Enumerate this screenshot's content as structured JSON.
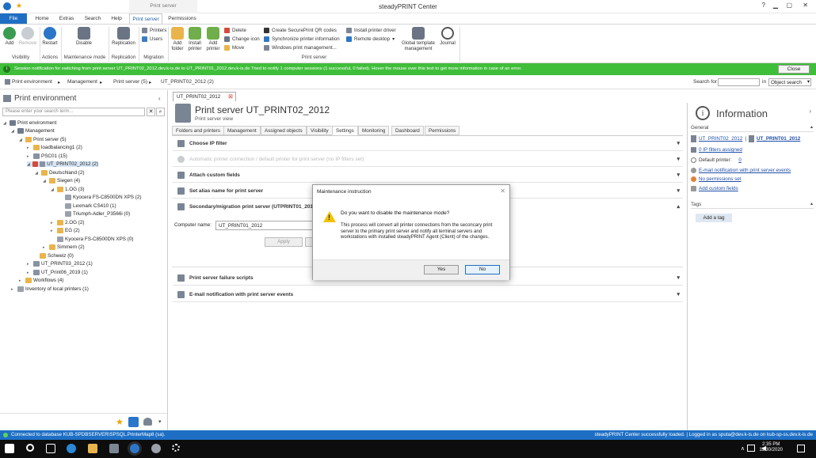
{
  "window": {
    "title": "steadyPRINT Center",
    "context_tab": "Print server"
  },
  "tabs": [
    {
      "label": "File"
    },
    {
      "label": "Home"
    },
    {
      "label": "Extras"
    },
    {
      "label": "Search"
    },
    {
      "label": "Help"
    },
    {
      "label": "Print server"
    },
    {
      "label": "Permissions"
    }
  ],
  "ribbon": {
    "add": "Add",
    "remove": "Remove",
    "restart": "Restart",
    "disable": "Disable",
    "replication": "Replication",
    "printers": "Printers",
    "users": "Users",
    "add_folder": "Add\nfolder",
    "install_printer": "Install\nprinter",
    "add_printer": "Add\nprinter",
    "delete": "Delete",
    "change_icon": "Change icon",
    "move": "Move",
    "create_qr": "Create SecurePrint QR codes",
    "sync_info": "Synchronize printer information",
    "windows_print": "Windows print management...",
    "install_driver": "Install printer driver",
    "remote_desktop": "Remote desktop",
    "global_template": "Global template\nmanagement",
    "journal": "Journal",
    "groups": {
      "visibility": "Visibility",
      "actions": "Actions",
      "maintenance": "Maintenance mode",
      "replication": "Replication",
      "migration": "Migration",
      "print_server": "Print server"
    }
  },
  "notification": {
    "text": "Session notification for switching from print server UT_PRINT02_2012.dev.k-is.de to UT_PRINT01_2012.dev.k-is.de Tried to notify 1 computer sessions (1 successful, 0 failed). Hover the mouse over this text to get more information in case of an error.",
    "close": "Close"
  },
  "breadcrumb": {
    "items": [
      "Print environment",
      "Management",
      "Print server (5)",
      "UT_PRINT02_2012 (2)"
    ],
    "search_for": "Search for",
    "in": "in",
    "scope": "Object search"
  },
  "left": {
    "title": "Print environment",
    "search_placeholder": "Please enter your search term...",
    "tree": [
      "Print environment",
      "Management",
      "Print server (5)",
      "loadbalancing1 (2)",
      "PSC01 (15)",
      "UT_PRINT02_2012 (2)",
      "Deutschland (2)",
      "Siegen (4)",
      "1.OG (3)",
      "Kyocera FS-C8500DN XPS (2)",
      "Lexmark CS410 (1)",
      "Triumph-Adler_P3566i (0)",
      "2.OG (2)",
      "EG (2)",
      "Kyocera FS-C8500DN XPS (0)",
      "Simmern (2)",
      "Schweiz (0)",
      "UT_PRINT03_2012 (1)",
      "UT_Print06_2019 (1)",
      "Workflows (4)",
      "Inventory of local printers (1)"
    ]
  },
  "center": {
    "tab_label": "UT_PRINT02_2012",
    "title": "Print server UT_PRINT02_2012",
    "subtitle": "Print server view",
    "tabs": [
      "Folders and printers",
      "Management",
      "Assigned objects",
      "Visibility",
      "Settings",
      "Monitoring",
      "Dashboard",
      "Permissions"
    ],
    "sections": {
      "ip": "Choose IP filter",
      "auto": "Automatic printer connection / default printer for print server (no IP filters set)",
      "custom": "Attach custom fields",
      "alias": "Set alias name for print server",
      "migration": "Secondary/migration print server (UTPRINT01_2012)",
      "failure": "Print server failure scripts",
      "email": "E-mail notification with print server events"
    },
    "computer_name_label": "Computer name:",
    "computer_name_value": "UT_PRINT01_2012",
    "apply": "Apply"
  },
  "info": {
    "title": "Information",
    "general": "General",
    "server_a": "UT_PRINT02_2012",
    "server_b": "UT_PRINT01_2012",
    "ip_filters": "0 IP filters assigned",
    "default_printer_label": "Default printer:",
    "default_printer_value": "0",
    "email": "E-mail notification with print server events",
    "permissions": "No permissions set",
    "custom": "Add custom fields",
    "tags": "Tags",
    "add_tag": "Add a tag"
  },
  "dialog": {
    "title": "Maintenance instruction",
    "question": "Do you want to disable the maintenance mode?",
    "body": "This process will convert all printer connections from the seconcary print server to the primary print server and notify all terminal servers and workstations with installed steadyPRINT Agent (Client) of the changes.",
    "yes": "Yes",
    "no": "No"
  },
  "status": {
    "left": "Connected to database KUB-SPDBSERVER\\SPSQL.PrinterMap8 (sa).",
    "right": "steadyPRINT Center successfully loaded. | Logged in as sputa@dev.k-is.de on kub-sp-ss.dev.k-is.de"
  },
  "taskbar": {
    "time": "2:35 PM",
    "date": "11/30/2020"
  }
}
